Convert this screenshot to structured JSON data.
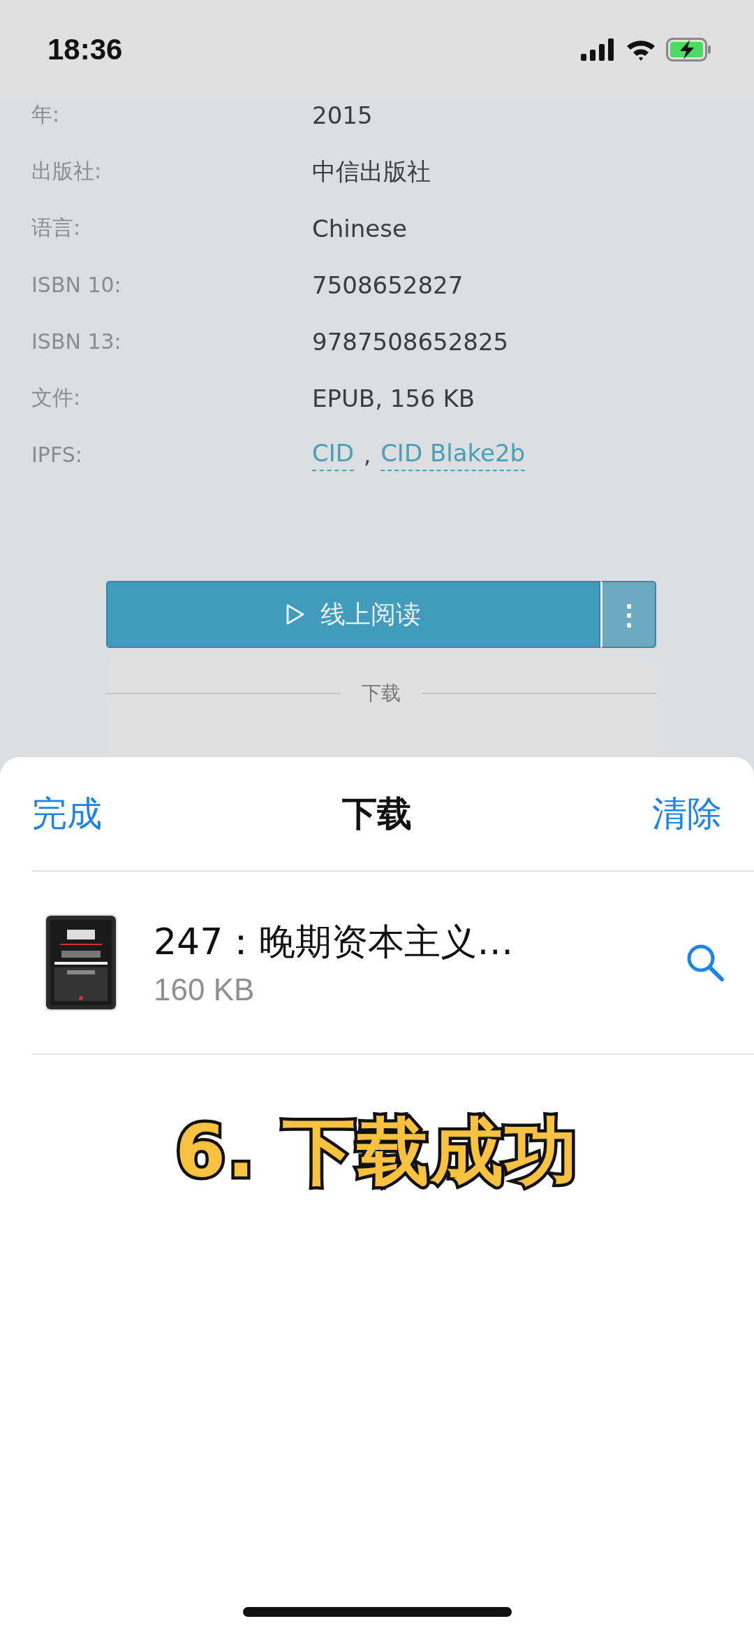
{
  "status_bar": {
    "time": "18:36"
  },
  "details": [
    {
      "label": "年:",
      "value": "2015",
      "kind": "text"
    },
    {
      "label": "出版社:",
      "value": "中信出版社",
      "kind": "text"
    },
    {
      "label": "语言:",
      "value": "Chinese",
      "kind": "text"
    },
    {
      "label": "ISBN 10:",
      "value": "7508652827",
      "kind": "text"
    },
    {
      "label": "ISBN 13:",
      "value": "9787508652825",
      "kind": "text"
    },
    {
      "label": "文件:",
      "value": "EPUB, 156 KB",
      "kind": "text"
    },
    {
      "label": "IPFS:",
      "kind": "links",
      "links": [
        "CID",
        "CID Blake2b"
      ],
      "separator": ","
    }
  ],
  "read_button": {
    "label": "线上阅读",
    "more": "⋮"
  },
  "download_card": {
    "title": "下载"
  },
  "sheet": {
    "done": "完成",
    "title": "下载",
    "clear": "清除",
    "files": [
      {
        "name": "247：晚期资本主义…",
        "size": "160 KB"
      }
    ]
  },
  "caption": "6. 下载成功"
}
